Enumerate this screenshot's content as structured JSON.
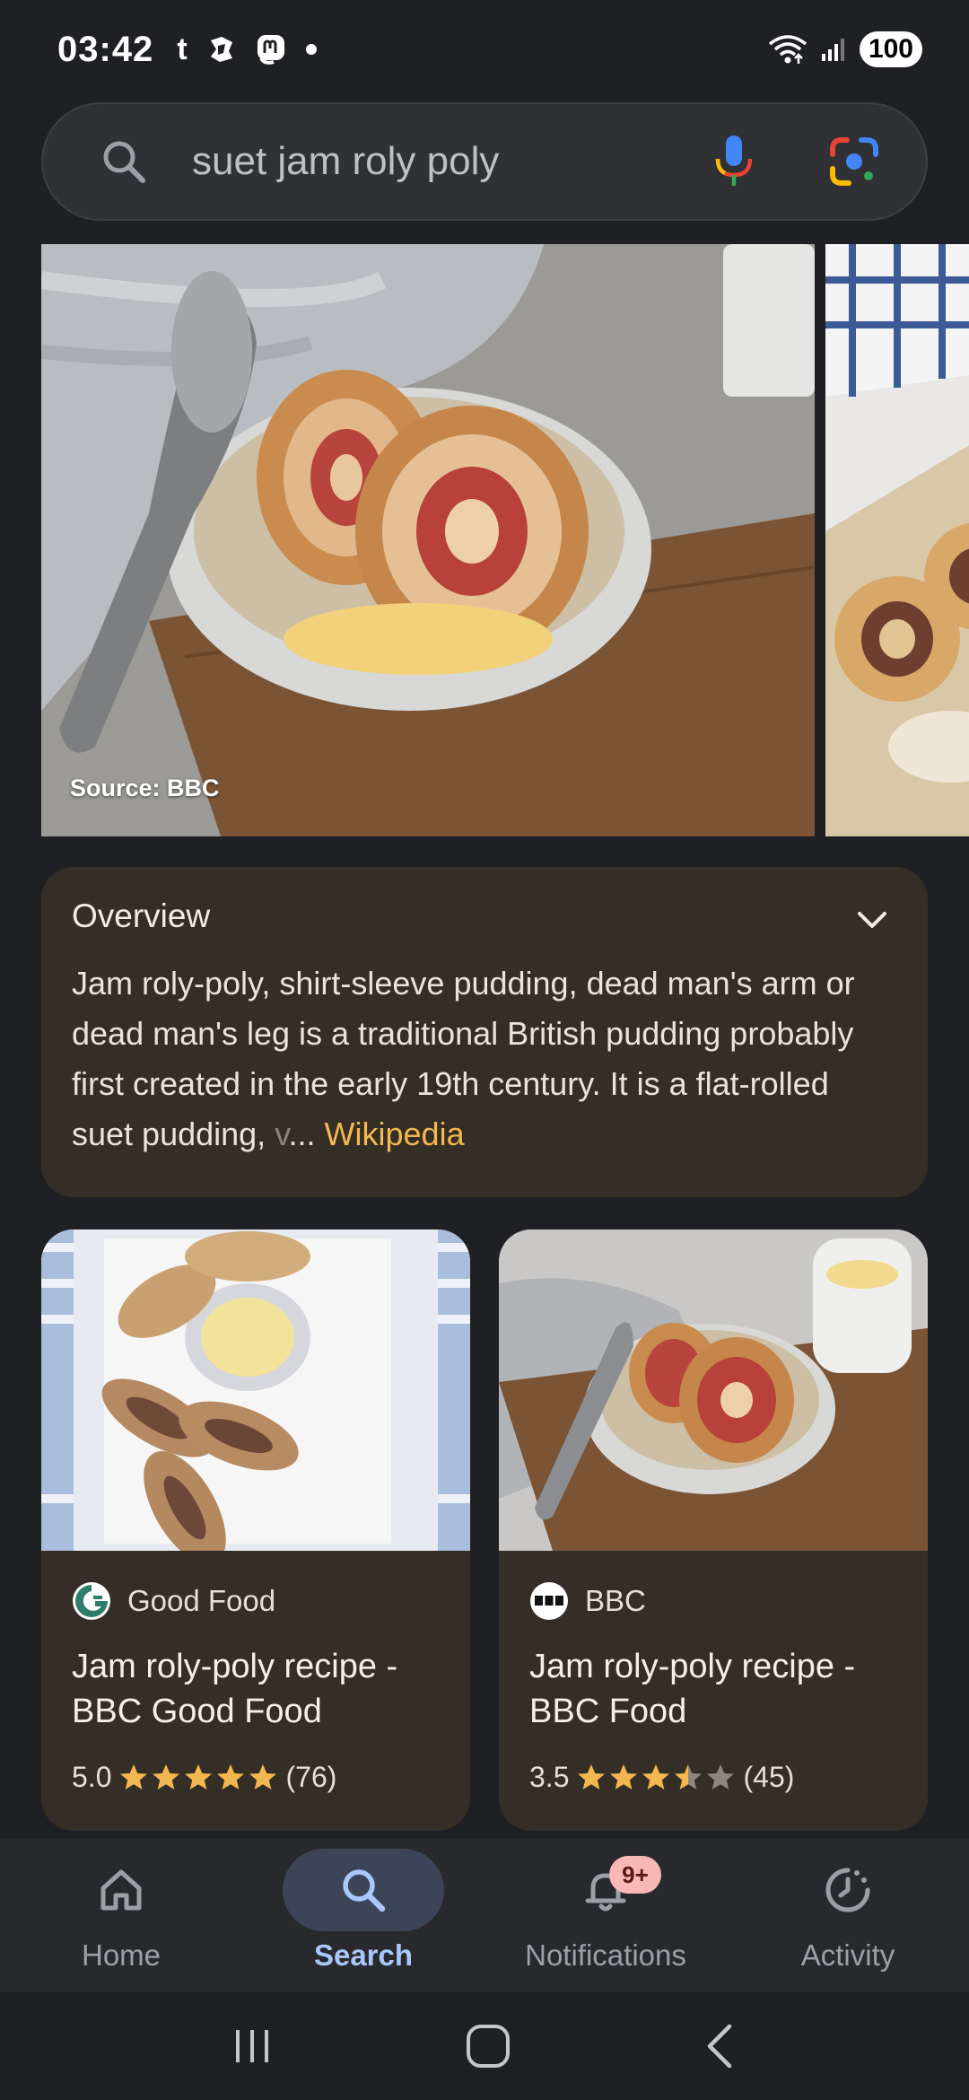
{
  "status_bar": {
    "time": "03:42",
    "app_glyph_1": "t",
    "battery": "100"
  },
  "search": {
    "query": "suet jam roly poly",
    "icons": [
      "search-icon",
      "microphone-icon",
      "lens-camera-icon"
    ]
  },
  "carousel": {
    "images": [
      {
        "source": "Source: BBC",
        "icon": "roly-poly-in-bowl-photo"
      },
      {
        "icon": "sliced-roly-poly-photo"
      }
    ]
  },
  "overview": {
    "title": "Overview",
    "text": "Jam roly-poly, shirt-sleeve pudding, dead man's arm or dead man's leg is a traditional British pudding probably first created in the early 19th century. It is a flat-rolled suet pudding, ",
    "faded": "v",
    "ellipsis": "... ",
    "source": "Wikipedia",
    "accent_color": "#f3b74f"
  },
  "cards": [
    {
      "source": "Good Food",
      "title": "Jam roly-poly recipe - BBC Good Food",
      "rating": "5.0",
      "stars": 5,
      "reviews": "(76)"
    },
    {
      "source": "BBC",
      "title": "Jam roly-poly recipe - BBC Food",
      "rating": "3.5",
      "stars": 3.5,
      "reviews": "(45)"
    }
  ],
  "bottom_nav": {
    "items": [
      {
        "label": "Home",
        "icon": "home-icon",
        "active": false
      },
      {
        "label": "Search",
        "icon": "search-icon",
        "active": true
      },
      {
        "label": "Notifications",
        "icon": "bell-icon",
        "active": false,
        "badge": "9+"
      },
      {
        "label": "Activity",
        "icon": "activity-icon",
        "active": false
      }
    ]
  },
  "colors": {
    "star_filled": "#f3b74f",
    "star_empty": "#8a8780",
    "active_nav": "#a8c7fa"
  }
}
